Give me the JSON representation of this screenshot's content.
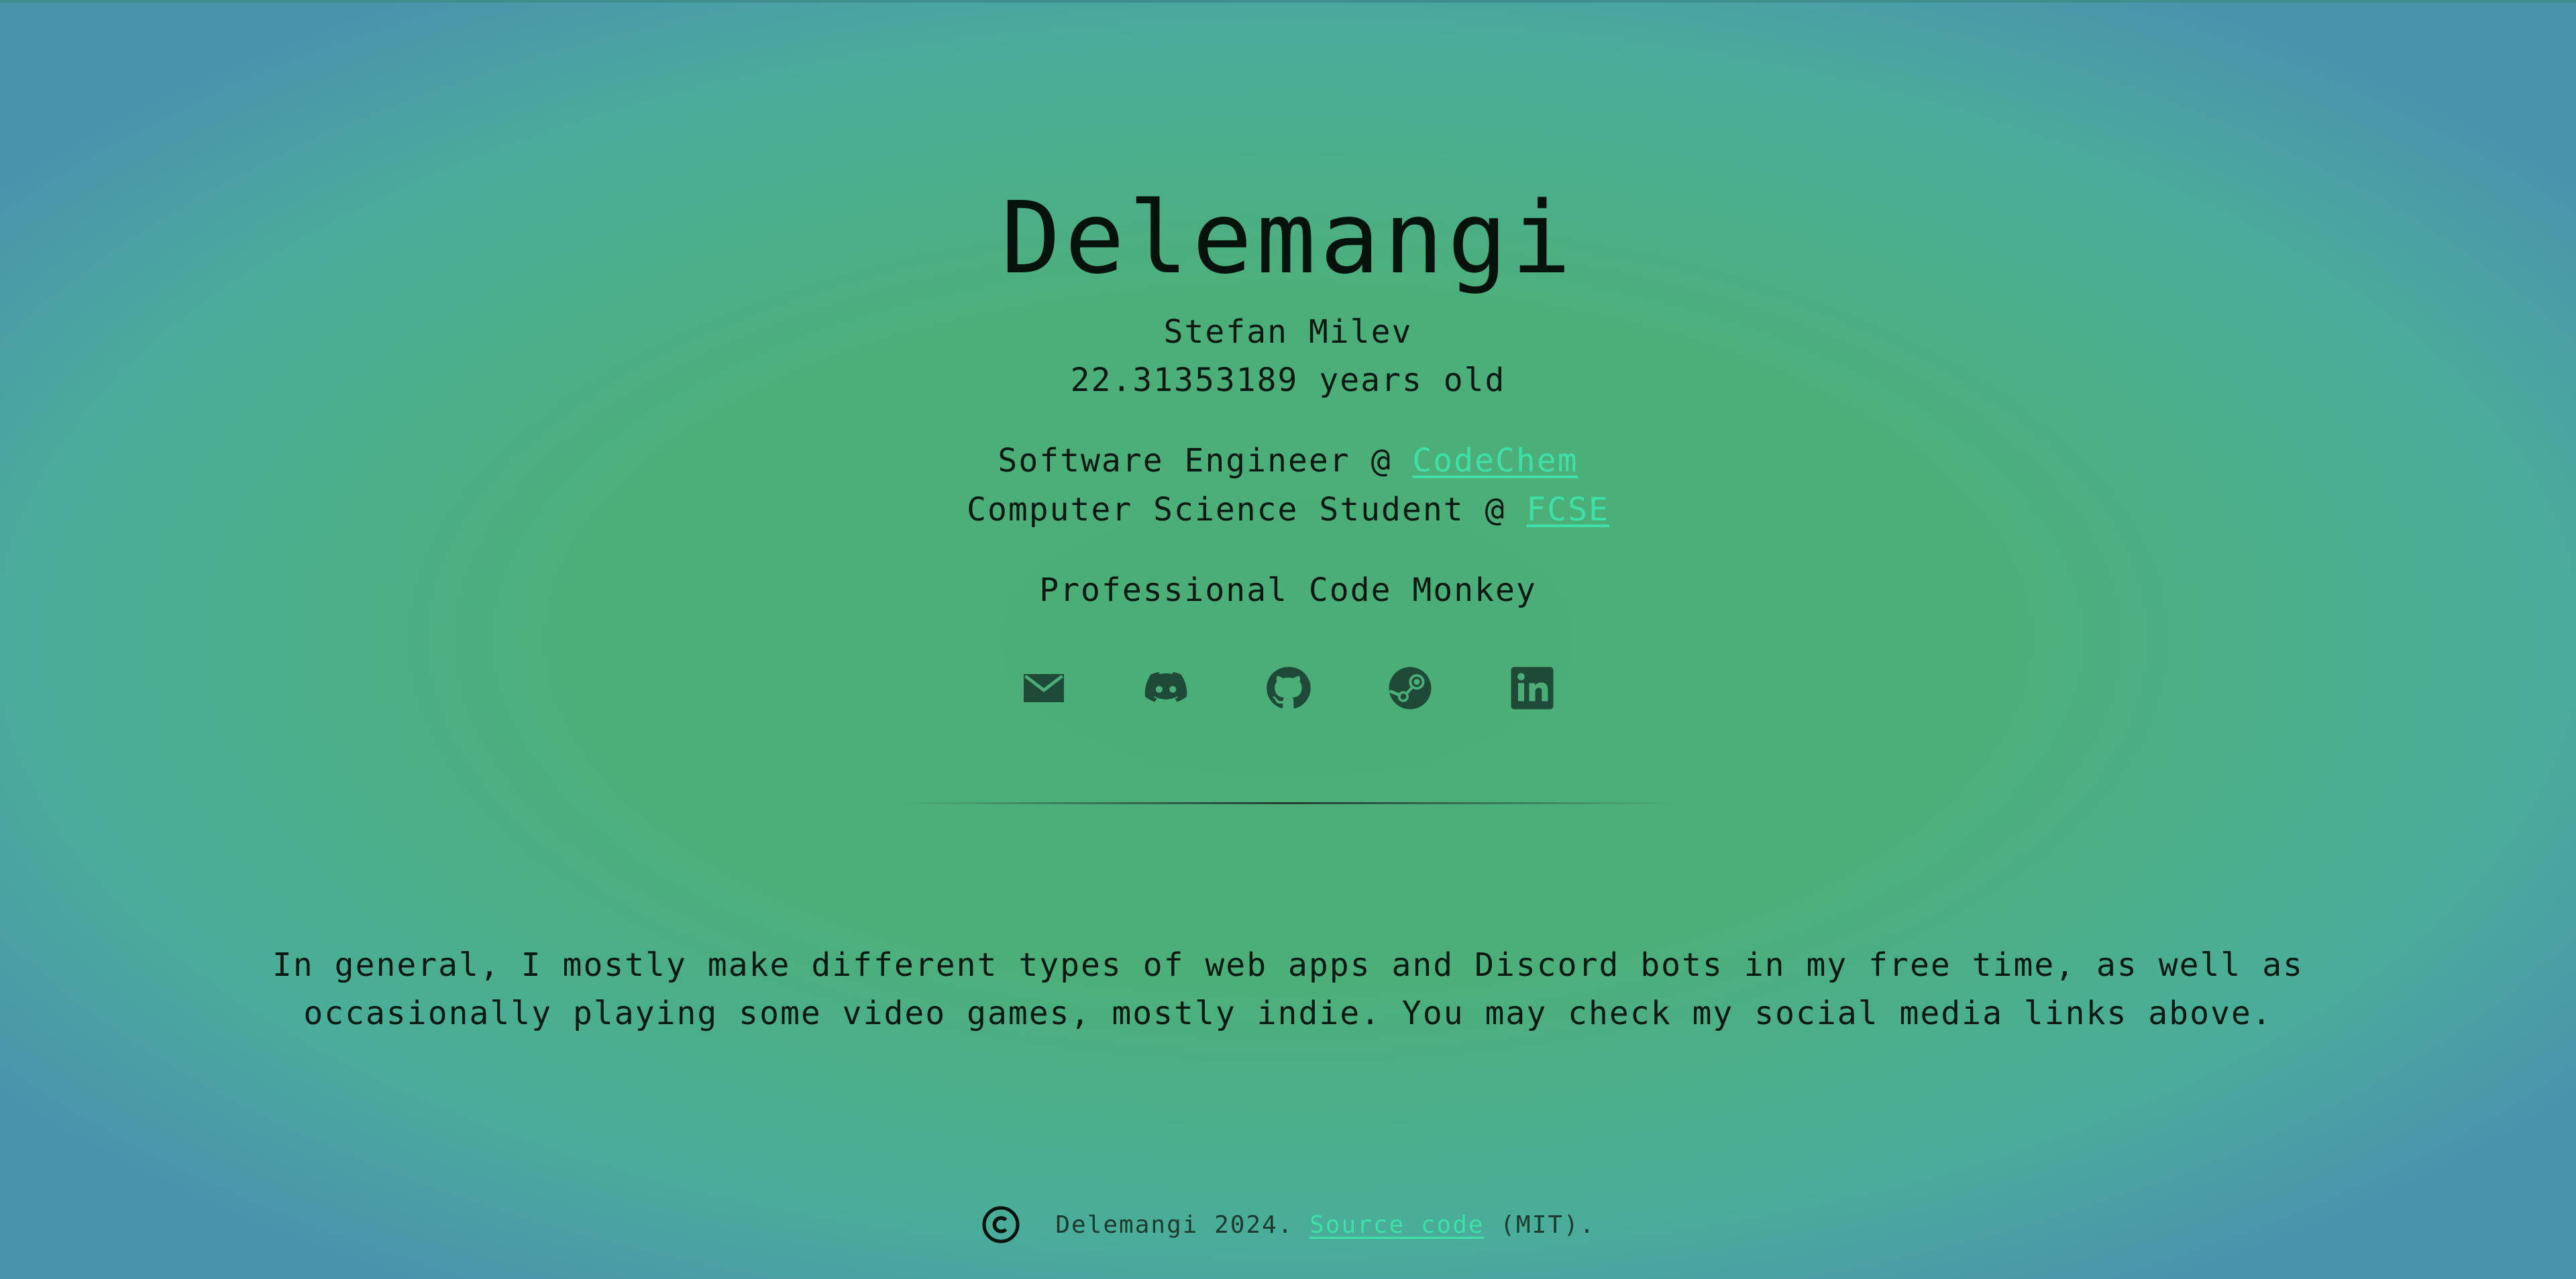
{
  "header": {
    "title": "Delemangi",
    "name": "Stefan Milev",
    "age": "22.31353189 years old"
  },
  "roles": {
    "job_prefix": "Software Engineer @ ",
    "job_link": "CodeChem",
    "study_prefix": "Computer Science Student @ ",
    "study_link": "FCSE",
    "tagline": "Professional Code Monkey"
  },
  "socials": [
    {
      "icon": "mail-icon"
    },
    {
      "icon": "discord-icon"
    },
    {
      "icon": "github-icon"
    },
    {
      "icon": "steam-icon"
    },
    {
      "icon": "linkedin-icon"
    }
  ],
  "about": {
    "text": "In general, I mostly make different types of web apps and Discord bots in my free time, as well as occasionally playing some video games, mostly indie. You may check my social media links above."
  },
  "footer": {
    "prefix": " Delemangi 2024. ",
    "link": "Source code",
    "suffix": " (MIT)."
  },
  "colors": {
    "background_center": "#4bad77",
    "background_edge": "#4a93ad",
    "link": "#3ee0a8",
    "icon": "#1f4a38"
  }
}
